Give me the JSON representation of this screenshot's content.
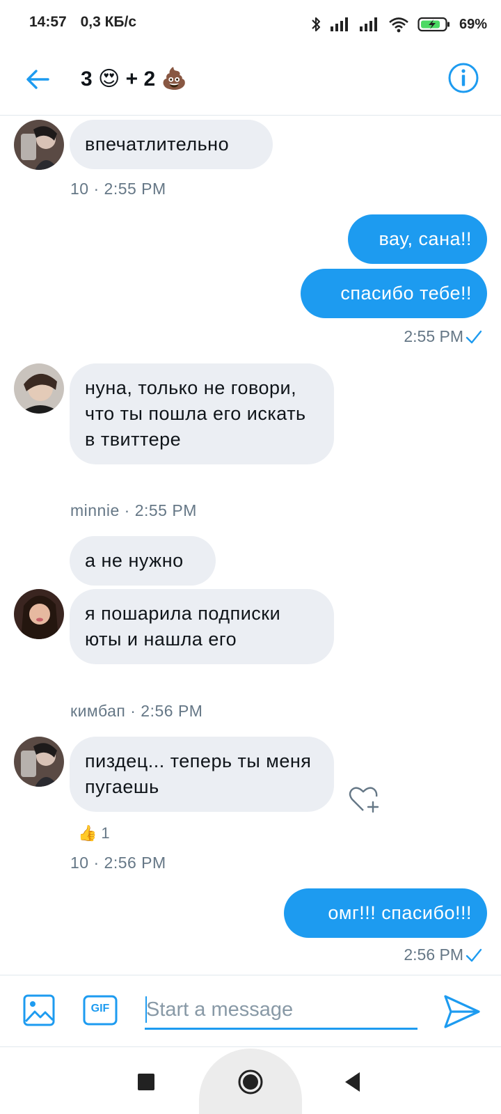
{
  "status_bar": {
    "time": "14:57",
    "speed": "0,3 КБ/с",
    "battery": "69%"
  },
  "header": {
    "title": "3 😍 + 2 💩",
    "accent_color": "#1d9bf0"
  },
  "messages": [
    {
      "side": "in",
      "text": "впечатлительно",
      "meta": "10 · 2:55 PM"
    },
    {
      "side": "out",
      "text": "вау, сана!!",
      "meta": ""
    },
    {
      "side": "out",
      "text": "спасибо тебе!!",
      "meta": "2:55 PM"
    },
    {
      "side": "in",
      "text": "нуна, только не говори, что ты пошла его искать в твиттере",
      "meta": "minnie · 2:55 PM"
    },
    {
      "side": "in",
      "text": "а не нужно",
      "meta": ""
    },
    {
      "side": "in",
      "text": "я пошарила подписки юты и нашла его",
      "meta": "кимбап · 2:56 PM"
    },
    {
      "side": "in",
      "text": "пиздец... теперь ты меня пугаешь",
      "meta": "10 · 2:56 PM",
      "reaction_emoji": "👍",
      "reaction_count": "1"
    },
    {
      "side": "out",
      "text": "омг!!! спасибо!!!",
      "meta": "2:56 PM"
    }
  ],
  "composer": {
    "placeholder": "Start a message",
    "gif_label": "GIF"
  },
  "icons": {
    "back": "arrow-left-icon",
    "info": "info-icon",
    "media": "image-icon",
    "gif": "gif-icon",
    "send": "send-icon",
    "like": "heart-plus-icon"
  }
}
